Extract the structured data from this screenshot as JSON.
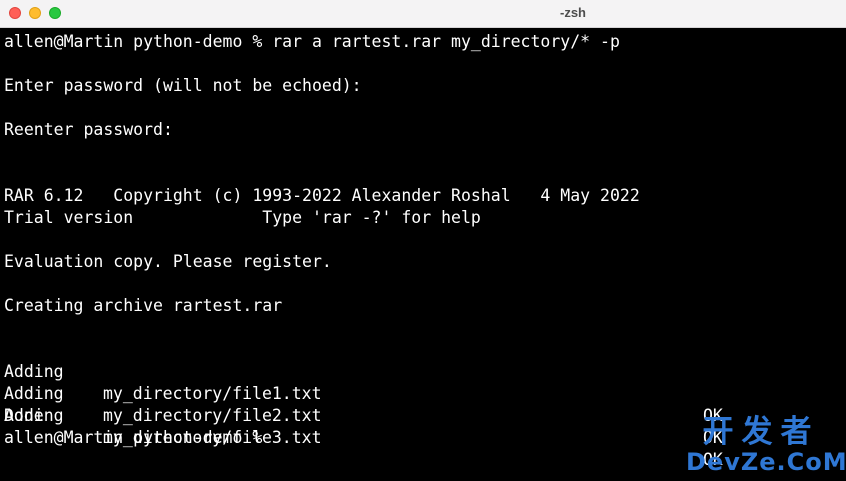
{
  "window": {
    "title": "-zsh"
  },
  "terminal": {
    "prompt_command": "allen@Martin python-demo % rar a rartest.rar my_directory/* -p",
    "password_prompt": "Enter password (will not be echoed):",
    "reenter_prompt": "Reenter password:",
    "version_line": "RAR 6.12   Copyright (c) 1993-2022 Alexander Roshal   4 May 2022",
    "trial_line": "Trial version             Type 'rar -?' for help",
    "evaluation_line": "Evaluation copy. Please register.",
    "creating_line": "Creating archive rartest.rar",
    "adding_rows": [
      {
        "verb": "Adding",
        "path": "my_directory/file1.txt",
        "status": "OK"
      },
      {
        "verb": "Adding",
        "path": "my_directory/file2.txt",
        "status": "OK"
      },
      {
        "verb": "Adding",
        "path": "my_directory/file3.txt",
        "status": "OK"
      }
    ],
    "done_line": "Done",
    "final_prompt": "allen@Martin python-demo %"
  },
  "watermark": {
    "chinese": "开发者",
    "english": "DevZe.CoM",
    "color": "#2f77d4"
  },
  "colors": {
    "terminal_background": "#000000",
    "terminal_text": "#ffffff",
    "close": "#ff5f57",
    "minimize": "#febc2e",
    "maximize": "#28c840"
  }
}
